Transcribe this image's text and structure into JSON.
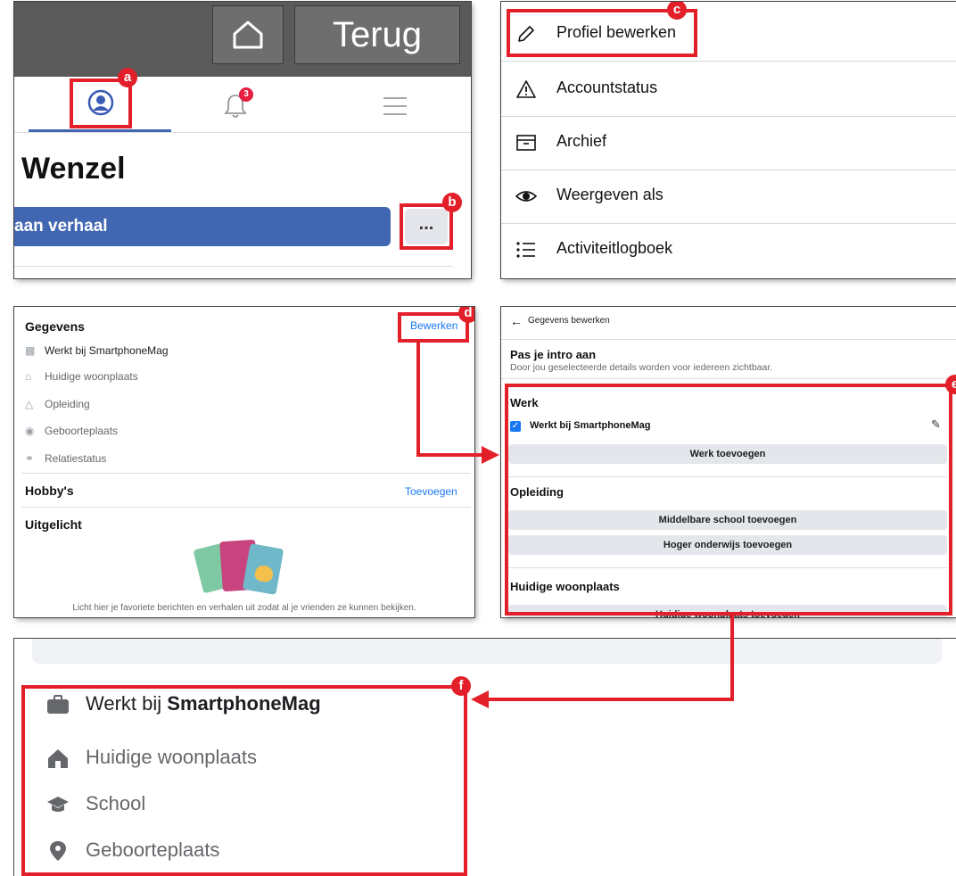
{
  "panel_profile": {
    "back_label": "Terug",
    "notification_count": "3",
    "profile_name": "Wenzel",
    "story_button_label": "aan verhaal",
    "more_button_label": "..."
  },
  "panel_menu": {
    "items": [
      {
        "label": "Profiel bewerken",
        "icon": "pencil-icon"
      },
      {
        "label": "Accountstatus",
        "icon": "warning-icon"
      },
      {
        "label": "Archief",
        "icon": "archive-icon"
      },
      {
        "label": "Weergeven als",
        "icon": "eye-icon"
      },
      {
        "label": "Activiteitlogboek",
        "icon": "list-icon"
      }
    ]
  },
  "panel_details": {
    "heading": "Gegevens",
    "edit_link": "Bewerken",
    "rows": [
      {
        "label": "Werkt bij SmartphoneMag",
        "icon": "briefcase-icon"
      },
      {
        "label": "Huidige woonplaats",
        "icon": "home-icon"
      },
      {
        "label": "Opleiding",
        "icon": "school-icon"
      },
      {
        "label": "Geboorteplaats",
        "icon": "location-icon"
      },
      {
        "label": "Relatiestatus",
        "icon": "relationship-icon"
      }
    ],
    "hobbies_heading": "Hobby's",
    "hobbies_add": "Toevoegen",
    "featured_heading": "Uitgelicht",
    "featured_caption": "Licht hier je favoriete berichten en verhalen uit zodat al je vrienden ze kunnen bekijken."
  },
  "panel_edit": {
    "back_title": "Gegevens bewerken",
    "intro_title": "Pas je intro aan",
    "intro_sub": "Door jou geselecteerde details worden voor iedereen zichtbaar.",
    "work_heading": "Werk",
    "work_item": "Werkt bij SmartphoneMag",
    "work_add": "Werk toevoegen",
    "edu_heading": "Opleiding",
    "edu_add_school": "Middelbare school toevoegen",
    "edu_add_higher": "Hoger onderwijs toevoegen",
    "city_heading": "Huidige woonplaats",
    "city_add": "Huidige woonplaats toevoegen"
  },
  "panel_result": {
    "work_prefix": "Werkt bij ",
    "work_company": "SmartphoneMag",
    "city": "Huidige woonplaats",
    "school": "School",
    "birthplace": "Geboorteplaats"
  },
  "badges": {
    "a": "a",
    "b": "b",
    "c": "c",
    "d": "d",
    "e": "e",
    "f": "f"
  },
  "colors": {
    "accent": "#e3202a",
    "facebook_blue": "#4267b2",
    "link_blue": "#1877f2"
  }
}
